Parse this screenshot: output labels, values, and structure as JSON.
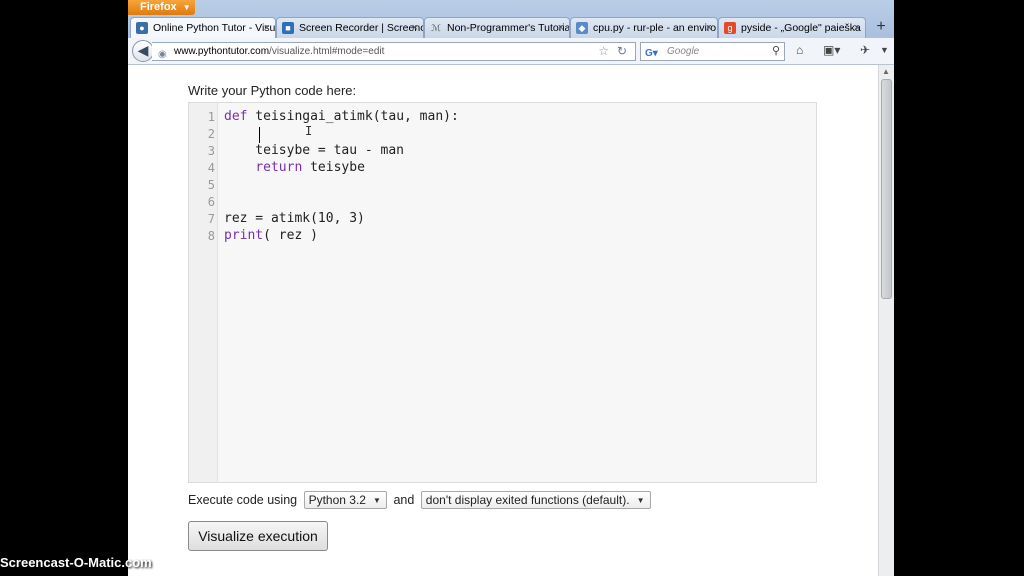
{
  "browser": {
    "app_button": "Firefox",
    "tabs": [
      {
        "label": "Online Python Tutor - Visu...",
        "active": true,
        "icon": "python-tutor-icon"
      },
      {
        "label": "Screen Recorder | Screenca...",
        "active": false,
        "icon": "screencast-icon"
      },
      {
        "label": "Non-Programmer's Tutoria...",
        "active": false,
        "icon": "wikibooks-icon"
      },
      {
        "label": "cpu.py - rur-ple - an enviro...",
        "active": false,
        "icon": "google-code-icon"
      },
      {
        "label": "pyside - „Google\" paieška",
        "active": false,
        "icon": "google-icon"
      }
    ],
    "url_host": "www.pythontutor.com",
    "url_path": "/visualize.html#mode=edit",
    "search_placeholder": "Google"
  },
  "page": {
    "prompt": "Write your Python code here:",
    "code_lines": [
      {
        "num": "1",
        "kw": "def",
        "text": " teisingai_atimk(tau, man):"
      },
      {
        "num": "2",
        "kw": "",
        "text": "    "
      },
      {
        "num": "3",
        "kw": "",
        "text": "    teisybe = tau - man"
      },
      {
        "num": "4",
        "kw": "return",
        "text": " teisybe",
        "indent": "    "
      },
      {
        "num": "5",
        "kw": "",
        "text": ""
      },
      {
        "num": "6",
        "kw": "",
        "text": ""
      },
      {
        "num": "7",
        "kw": "",
        "text": "rez = atimk(10, 3)"
      },
      {
        "num": "8",
        "kw": "print",
        "text": "( rez )"
      }
    ],
    "execute_prefix": "Execute code using",
    "python_version": "Python 3.2",
    "and_label": "and",
    "display_option": "don't display exited functions (default).",
    "visualize_button": "Visualize execution"
  },
  "watermark": "Screencast-O-Matic.com"
}
